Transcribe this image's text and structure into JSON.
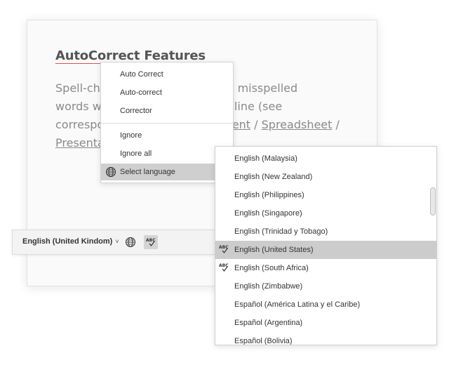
{
  "document": {
    "title": "AutoCorrect Features",
    "line1": "Spell-che",
    "line1_tail": "ult. All misspelled",
    "line2": "words w",
    "line2_tail": "ed line (see",
    "line3": "correspo",
    "line3_link1": "ment",
    "line3_sep1": " / ",
    "line3_link2": "Spreadsheet",
    "line3_sep2": " /",
    "line4_link": "Presenta"
  },
  "context_menu": {
    "items": [
      {
        "label": "Auto Correct"
      },
      {
        "label": "Auto-correct"
      },
      {
        "label": "Corrector"
      },
      {
        "label": "Ignore"
      },
      {
        "label": "Ignore all"
      },
      {
        "label": "Select language",
        "icon": "globe-icon",
        "selected": true
      }
    ]
  },
  "toolbar": {
    "language_label": "English (United Kindom)",
    "chevron": "˅",
    "globe_icon": "globe-icon",
    "spellcheck_icon": "spellcheck-abc-icon"
  },
  "language_list": {
    "options": [
      {
        "label": "English (Malaysia)"
      },
      {
        "label": "English (New Zealand)"
      },
      {
        "label": "English (Philippines)"
      },
      {
        "label": "English (Singapore)"
      },
      {
        "label": "English (Trinidad y Tobago)"
      },
      {
        "label": "English (United States)",
        "selected": true,
        "has_dictionary": true
      },
      {
        "label": "English (South Africa)",
        "has_dictionary": true
      },
      {
        "label": "English (Zimbabwe)"
      },
      {
        "label": "Español (América Latina y el Caribe)"
      },
      {
        "label": "Español (Argentina)"
      },
      {
        "label": "Español (Bolivia)"
      }
    ]
  },
  "colors": {
    "accent_underline": "#d9534f",
    "selection_bg": "#cccccc"
  }
}
